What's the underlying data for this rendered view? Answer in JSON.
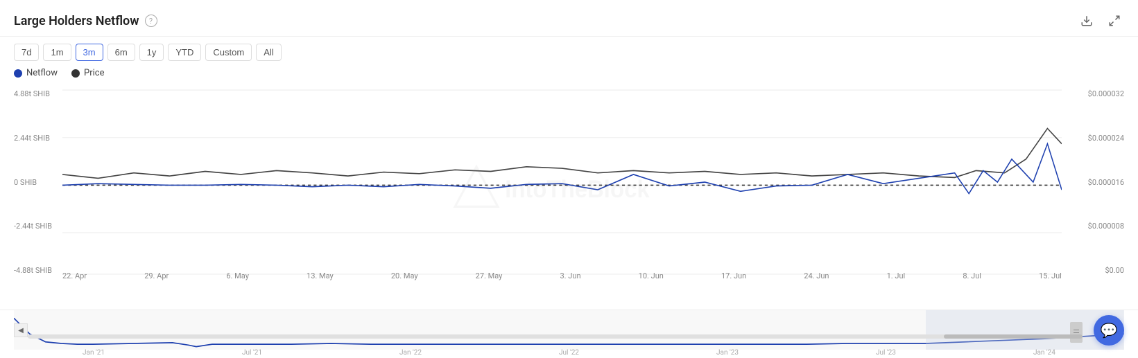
{
  "header": {
    "title": "Large Holders Netflow",
    "help_tooltip": "?",
    "download_icon": "⬇",
    "expand_icon": "⤢"
  },
  "time_filters": [
    {
      "label": "7d",
      "active": false
    },
    {
      "label": "1m",
      "active": false
    },
    {
      "label": "3m",
      "active": true
    },
    {
      "label": "6m",
      "active": false
    },
    {
      "label": "1y",
      "active": false
    },
    {
      "label": "YTD",
      "active": false
    },
    {
      "label": "Custom",
      "active": false
    },
    {
      "label": "All",
      "active": false
    }
  ],
  "legend": [
    {
      "label": "Netflow",
      "color": "blue"
    },
    {
      "label": "Price",
      "color": "dark"
    }
  ],
  "y_axis_left": [
    "4.88t SHIB",
    "2.44t SHIB",
    "0 SHIB",
    "-2.44t SHIB",
    "-4.88t SHIB"
  ],
  "y_axis_right": [
    "$0.000032",
    "$0.000024",
    "$0.000016",
    "$0.000008",
    "$0.00"
  ],
  "x_axis": [
    "22. Apr",
    "29. Apr",
    "6. May",
    "13. May",
    "20. May",
    "27. May",
    "3. Jun",
    "10. Jun",
    "17. Jun",
    "24. Jun",
    "1. Jul",
    "8. Jul",
    "15. Jul"
  ],
  "mini_x_axis": [
    "Jan '21",
    "Jul '21",
    "Jan '22",
    "Jul '22",
    "Jan '23",
    "Jul '23",
    "Jan '24"
  ],
  "watermark": "IntoTheBlock"
}
